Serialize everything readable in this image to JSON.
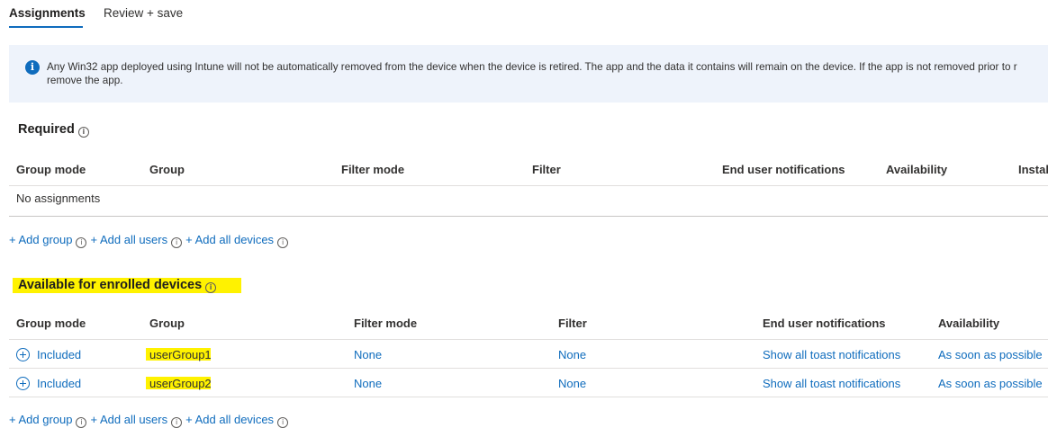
{
  "tabs": [
    {
      "label": "Assignments",
      "active": true
    },
    {
      "label": "Review + save",
      "active": false
    }
  ],
  "banner": {
    "icon": "info-icon",
    "text": "Any Win32 app deployed using Intune will not be automatically removed from the device when the device is retired. The app and the data it contains will remain on the device. If the app is not removed prior to r remove the app."
  },
  "required": {
    "title": "Required",
    "columns": [
      "Group mode",
      "Group",
      "Filter mode",
      "Filter",
      "End user notifications",
      "Availability",
      "Instal"
    ],
    "empty_text": "No assignments",
    "actions": {
      "add_group": "+ Add group",
      "add_all_users": "+ Add all users",
      "add_all_devices": "+ Add all devices"
    }
  },
  "available": {
    "title": "Available for enrolled devices",
    "columns": [
      "Group mode",
      "Group",
      "Filter mode",
      "Filter",
      "End user notifications",
      "Availability"
    ],
    "rows": [
      {
        "group_mode": "Included",
        "group": "userGroup1",
        "filter_mode": "None",
        "filter": "None",
        "notifications": "Show all toast notifications",
        "availability": "As soon as possible"
      },
      {
        "group_mode": "Included",
        "group": "userGroup2",
        "filter_mode": "None",
        "filter": "None",
        "notifications": "Show all toast notifications",
        "availability": "As soon as possible"
      }
    ],
    "actions": {
      "add_group": "+ Add group",
      "add_all_users": "+ Add all users",
      "add_all_devices": "+ Add all devices"
    }
  },
  "colors": {
    "accent": "#0f6cbd",
    "highlight": "#fff200",
    "banner_bg": "#eef3fb"
  }
}
